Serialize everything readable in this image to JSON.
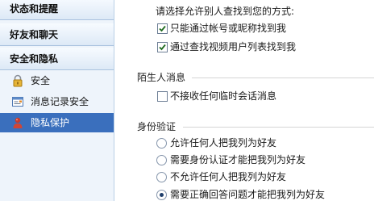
{
  "sidebar": {
    "categories": [
      {
        "label": "状态和提醒"
      },
      {
        "label": "好友和聊天"
      },
      {
        "label": "安全和隐私"
      }
    ],
    "items": [
      {
        "label": "安全",
        "icon": "lock-icon"
      },
      {
        "label": "消息记录安全",
        "icon": "chat-log-icon"
      },
      {
        "label": "隐私保护",
        "icon": "user-privacy-icon"
      }
    ]
  },
  "find_me": {
    "prompt": "请选择允许别人查找到您的方式:",
    "options": [
      {
        "label": "只能通过帐号或昵称找到我",
        "checked": true
      },
      {
        "label": "通过查找视频用户列表找到我",
        "checked": true
      }
    ]
  },
  "stranger": {
    "title": "陌生人消息",
    "option": {
      "label": "不接收任何临时会话消息",
      "checked": false
    }
  },
  "auth": {
    "title": "身份验证",
    "options": [
      {
        "label": "允许任何人把我列为好友",
        "selected": false
      },
      {
        "label": "需要身份认证才能把我列为好友",
        "selected": false
      },
      {
        "label": "不允许任何人把我列为好友",
        "selected": false
      },
      {
        "label": "需要正确回答问题才能把我列为好友",
        "selected": true
      }
    ]
  },
  "colors": {
    "selected_bg": "#3a6fbd",
    "sidebar_bg": "#eef4fb",
    "check_color": "#1f6b1f"
  }
}
